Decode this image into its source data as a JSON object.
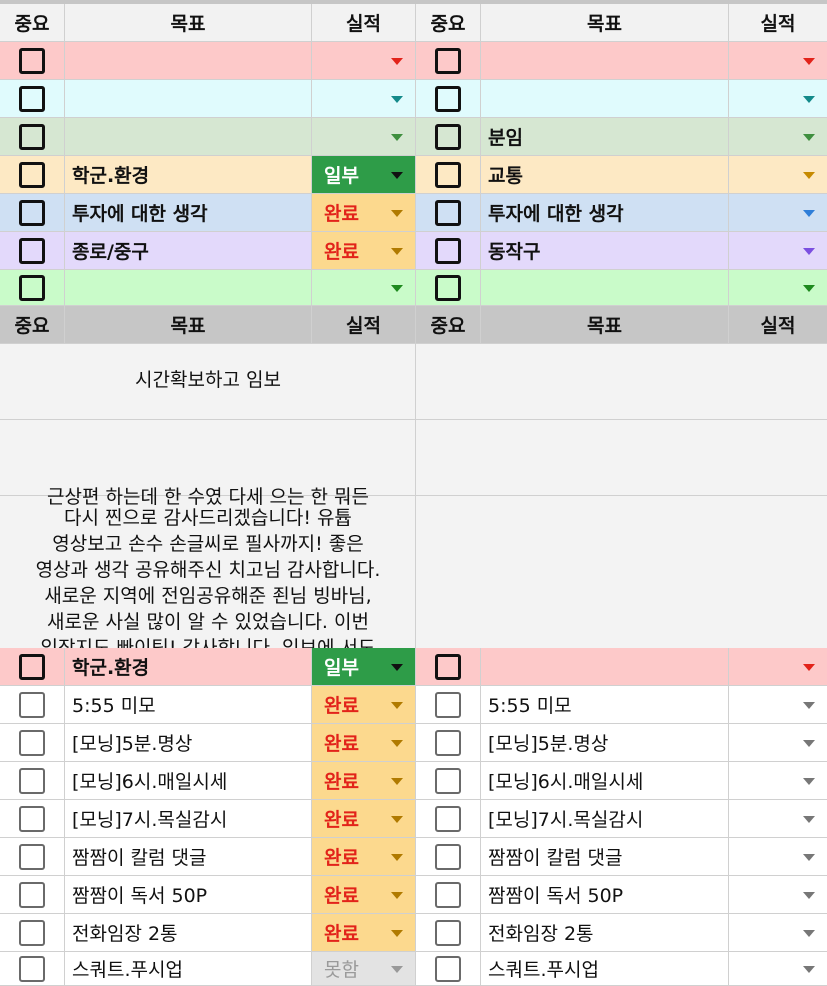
{
  "header": {
    "importance": "중요",
    "goal": "목표",
    "result": "실적"
  },
  "top_rows": [
    {
      "left_goal": "",
      "left_status": "",
      "right_goal": ""
    },
    {
      "left_goal": "",
      "left_status": "",
      "right_goal": ""
    },
    {
      "left_goal": "",
      "left_status": "",
      "right_goal": "분임"
    },
    {
      "left_goal": "학군.환경",
      "left_status": "일부",
      "right_goal": "교통"
    },
    {
      "left_goal": "투자에 대한 생각",
      "left_status": "완료",
      "right_goal": "투자에 대한 생각"
    },
    {
      "left_goal": "종로/중구",
      "left_status": "완료",
      "right_goal": "동작구"
    },
    {
      "left_goal": "",
      "left_status": "",
      "right_goal": ""
    }
  ],
  "notes": {
    "note1": "시간확보하고 임보",
    "cutoff_top": "근상편 하는데 한 수였 다세 으는 한 뭐든",
    "lines": [
      "다시 찐으로 감사드리겠습니다! 유튭",
      "영상보고 손수 손글씨로 필사까지! 좋은",
      "영상과 생각 공유해주신 치고님 감사합니다.",
      "새로운 지역에 전임공유해준 죈님 빙바님,",
      "새로운 사실 많이 알 수 있었습니다. 이번",
      "임장지도 빠이팅! 감사합니다. 임보에 서도"
    ]
  },
  "bottom_rows": [
    {
      "left_goal": "학군.환경",
      "left_status": "일부",
      "right_goal": ""
    },
    {
      "left_goal": "5:55 미모",
      "left_status": "완료",
      "right_goal": "5:55 미모"
    },
    {
      "left_goal": "[모닝]5분.명상",
      "left_status": "완료",
      "right_goal": "[모닝]5분.명상"
    },
    {
      "left_goal": "[모닝]6시.매일시세",
      "left_status": "완료",
      "right_goal": "[모닝]6시.매일시세"
    },
    {
      "left_goal": "[모닝]7시.목실감시",
      "left_status": "완료",
      "right_goal": "[모닝]7시.목실감시"
    },
    {
      "left_goal": "짬짬이 칼럼 댓글",
      "left_status": "완료",
      "right_goal": "짬짬이 칼럼 댓글"
    },
    {
      "left_goal": "짬짬이 독서 50P",
      "left_status": "완료",
      "right_goal": "짬짬이 독서 50P"
    },
    {
      "left_goal": "전화임장 2통",
      "left_status": "완료",
      "right_goal": "전화임장 2통"
    },
    {
      "left_goal": "스쿼트.푸시업",
      "left_status": "못함",
      "right_goal": "스쿼트.푸시업"
    }
  ],
  "colors": {
    "row_red": "#fdc9c9",
    "row_cyan": "#e0fbfd",
    "row_sage": "#d6e7d2",
    "row_yellow": "#fde9c4",
    "row_blue": "#cfe0f3",
    "row_purple": "#e3d9fb",
    "row_green": "#c9fbc9",
    "header_gray": "#c6c6c6",
    "done_yellow": "#fcd98e",
    "done_red": "#e2231a",
    "partial_green": "#2e9c48",
    "not_done_gray": "#e3e3e3"
  },
  "icons": {
    "dropdown": "triangle-down-icon",
    "checkbox": "checkbox-icon"
  }
}
